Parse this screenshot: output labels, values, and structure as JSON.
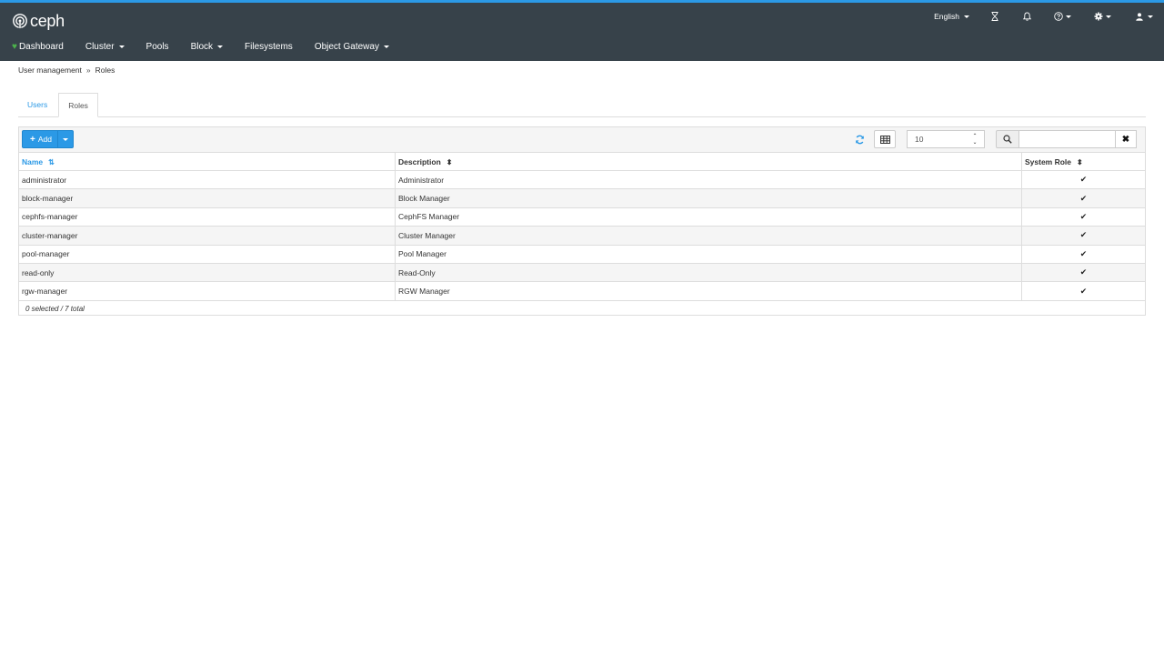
{
  "brand": {
    "logo_text": "ceph"
  },
  "utilities": {
    "language": "English",
    "icons": [
      "hourglass-icon",
      "bell-icon",
      "help-icon",
      "gear-icon",
      "user-icon"
    ]
  },
  "nav": {
    "items": [
      {
        "label": "Dashboard",
        "dropdown": false
      },
      {
        "label": "Cluster",
        "dropdown": true
      },
      {
        "label": "Pools",
        "dropdown": false
      },
      {
        "label": "Block",
        "dropdown": true
      },
      {
        "label": "Filesystems",
        "dropdown": false
      },
      {
        "label": "Object Gateway",
        "dropdown": true
      }
    ]
  },
  "breadcrumb": {
    "items": [
      "User management",
      "Roles"
    ],
    "separator": "»"
  },
  "tabs": [
    {
      "label": "Users",
      "active": false
    },
    {
      "label": "Roles",
      "active": true
    }
  ],
  "toolbar": {
    "add_label": "Add",
    "page_size": "10",
    "search_placeholder": ""
  },
  "table": {
    "columns": [
      {
        "label": "Name",
        "sorted": true
      },
      {
        "label": "Description",
        "sorted": false
      },
      {
        "label": "System Role",
        "sorted": false
      }
    ],
    "rows": [
      {
        "name": "administrator",
        "description": "Administrator",
        "system": true
      },
      {
        "name": "block-manager",
        "description": "Block Manager",
        "system": true
      },
      {
        "name": "cephfs-manager",
        "description": "CephFS Manager",
        "system": true
      },
      {
        "name": "cluster-manager",
        "description": "Cluster Manager",
        "system": true
      },
      {
        "name": "pool-manager",
        "description": "Pool Manager",
        "system": true
      },
      {
        "name": "read-only",
        "description": "Read-Only",
        "system": true
      },
      {
        "name": "rgw-manager",
        "description": "RGW Manager",
        "system": true
      }
    ],
    "footer": "0 selected / 7 total"
  },
  "colors": {
    "navbar": "#37424a",
    "accent": "#2b99e6",
    "health_ok": "#4cb24c"
  }
}
